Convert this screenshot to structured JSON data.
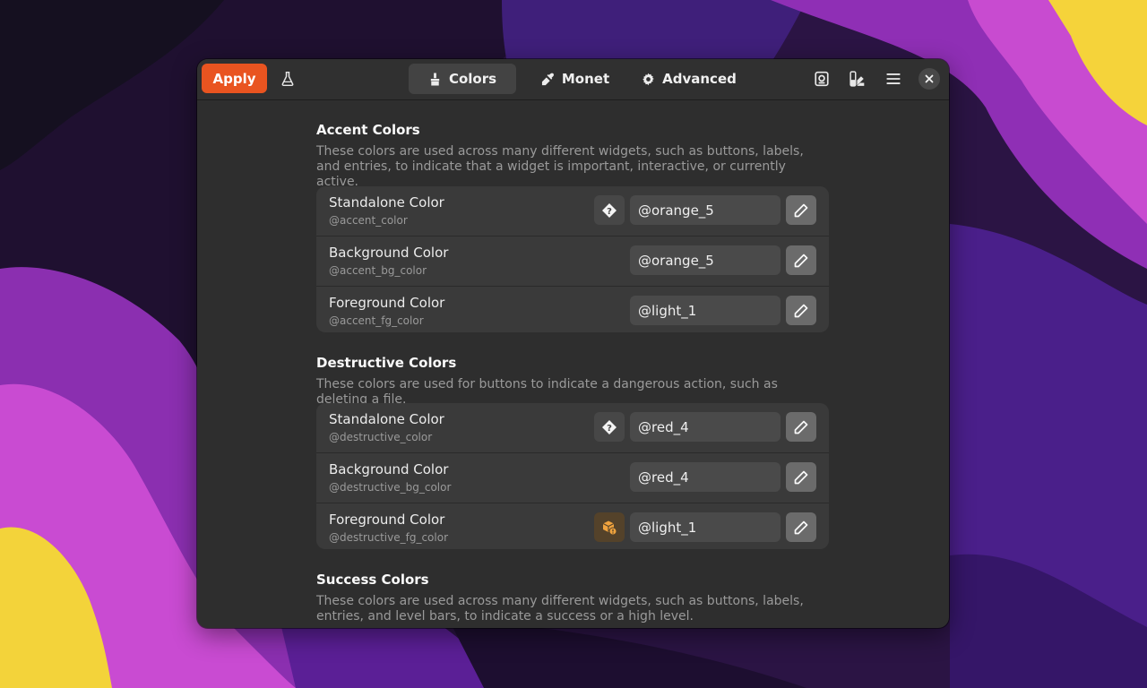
{
  "window": {
    "apply_label": "Apply",
    "tabs": [
      {
        "label": "Colors",
        "icon": "brush-icon",
        "active": true
      },
      {
        "label": "Monet",
        "icon": "eyedropper-icon",
        "active": false
      },
      {
        "label": "Advanced",
        "icon": "gear-icon",
        "active": false
      }
    ],
    "header_icons": [
      "flask-icon",
      "preset-icon",
      "palette-icon",
      "menu-icon",
      "close-icon"
    ]
  },
  "sections": [
    {
      "title": "Accent Colors",
      "description": "These colors are used across many different widgets, such as buttons, labels, and entries, to indicate that a widget is important, interactive, or currently active.",
      "rows": [
        {
          "title": "Standalone Color",
          "subtitle": "@accent_color",
          "value": "@orange_5",
          "warning": "?"
        },
        {
          "title": "Background Color",
          "subtitle": "@accent_bg_color",
          "value": "@orange_5"
        },
        {
          "title": "Foreground Color",
          "subtitle": "@accent_fg_color",
          "value": "@light_1"
        }
      ]
    },
    {
      "title": "Destructive Colors",
      "description": "These colors are used for buttons to indicate a dangerous action, such as deleting a file.",
      "rows": [
        {
          "title": "Standalone Color",
          "subtitle": "@destructive_color",
          "value": "@red_4",
          "warning": "?"
        },
        {
          "title": "Background Color",
          "subtitle": "@destructive_bg_color",
          "value": "@red_4"
        },
        {
          "title": "Foreground Color",
          "subtitle": "@destructive_fg_color",
          "value": "@light_1",
          "warning_icon": "package-warning-icon"
        }
      ]
    },
    {
      "title": "Success Colors",
      "description": "These colors are used across many different widgets, such as buttons, labels, entries, and level bars, to indicate a success or a high level."
    }
  ],
  "colors": {
    "accent": "#e95420",
    "window_bg": "#2e2e2e",
    "row_bg": "#3a3a3a",
    "warning_orange": "#f0a33e"
  }
}
